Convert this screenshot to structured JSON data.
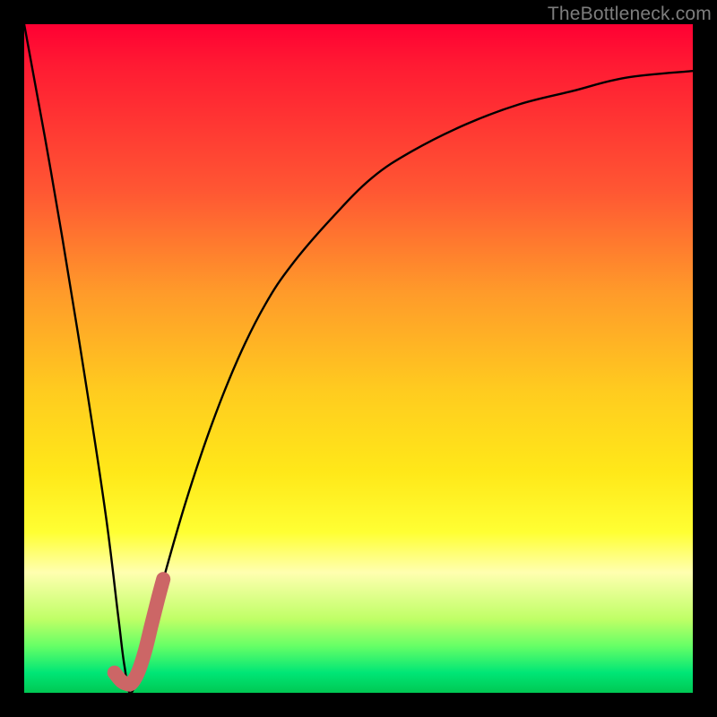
{
  "watermark": {
    "text": "TheBottleneck.com"
  },
  "chart_data": {
    "type": "line",
    "title": "",
    "xlabel": "",
    "ylabel": "",
    "xlim": [
      0,
      100
    ],
    "ylim": [
      0,
      100
    ],
    "grid": false,
    "legend": false,
    "series": [
      {
        "name": "bottleneck-curve",
        "x": [
          0,
          4,
          8,
          12,
          14,
          15,
          16,
          18,
          20,
          24,
          28,
          32,
          36,
          40,
          46,
          52,
          58,
          66,
          74,
          82,
          90,
          100
        ],
        "y": [
          100,
          78,
          54,
          28,
          12,
          4,
          0,
          6,
          14,
          28,
          40,
          50,
          58,
          64,
          71,
          77,
          81,
          85,
          88,
          90,
          92,
          93
        ]
      },
      {
        "name": "highlight-segment",
        "x": [
          13.5,
          14.5,
          15.2,
          16.0,
          17.0,
          18.0,
          19.0,
          20.0,
          20.8
        ],
        "y": [
          3.0,
          1.8,
          1.4,
          1.4,
          3.0,
          6.0,
          10.0,
          14.0,
          17.0
        ]
      }
    ],
    "highlight_color": "#cc6666",
    "curve_color": "#000000"
  }
}
